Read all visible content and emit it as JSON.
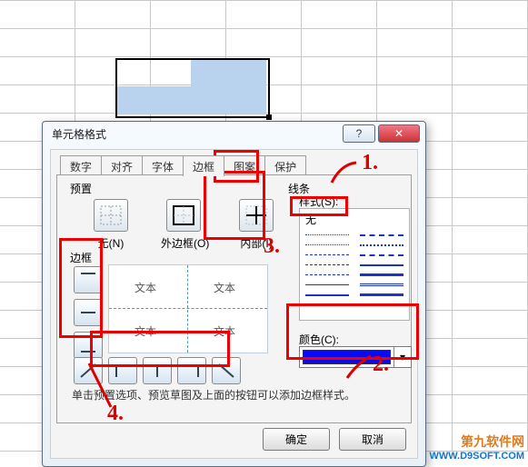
{
  "spreadsheet": {
    "preview_text": "文本"
  },
  "dialog": {
    "title": "单元格格式",
    "tabs": [
      "数字",
      "对齐",
      "字体",
      "边框",
      "图案",
      "保护"
    ],
    "selected_tab": 3,
    "preset_label": "预置",
    "presets": {
      "none": "无(N)",
      "outer": "外边框(O)",
      "inner": "内部(I)"
    },
    "border_label": "边框",
    "line_label": "线条",
    "style_label": "样式(S):",
    "style_none": "无",
    "color_label": "颜色(C):",
    "color_value": "#0a0af0",
    "help_text": "单击预置选项、预览草图及上面的按钮可以添加边框样式。",
    "ok": "确定",
    "cancel": "取消"
  },
  "annotations": {
    "n1": "1.",
    "n2": "2.",
    "n3": "3.",
    "n4": "4."
  },
  "watermark": {
    "line1": "第九软件网",
    "line2": "WWW.D9SOFT.COM"
  }
}
